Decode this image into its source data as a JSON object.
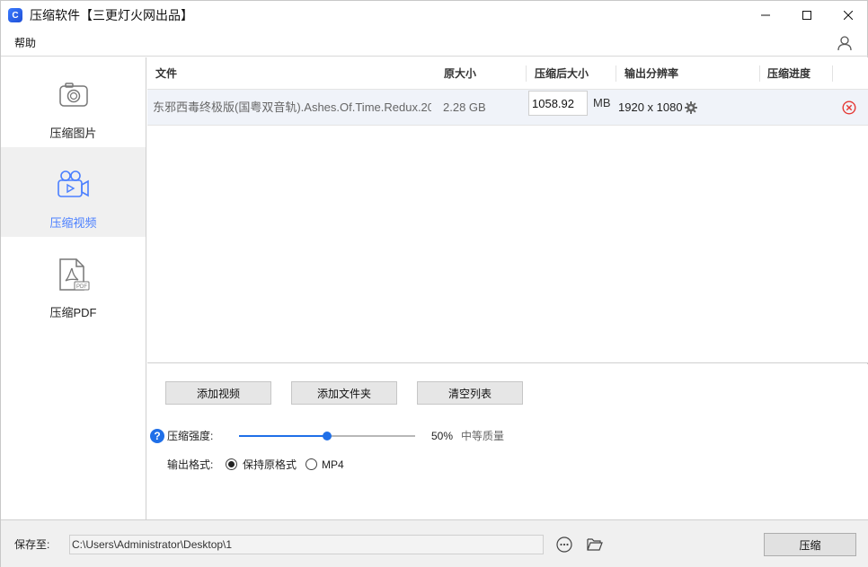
{
  "window": {
    "title": "压缩软件【三更灯火网出品】",
    "app_icon_letter": "C",
    "accent": "#4a7fff"
  },
  "menu": {
    "help_label": "帮助"
  },
  "sidebar": {
    "items": [
      {
        "label": "压缩图片",
        "icon": "camera-icon",
        "active": false
      },
      {
        "label": "压缩视频",
        "icon": "video-camera-icon",
        "active": true
      },
      {
        "label": "压缩PDF",
        "icon": "pdf-file-icon",
        "active": false
      }
    ]
  },
  "table": {
    "columns": [
      "文件",
      "原大小",
      "压缩后大小",
      "输出分辨率",
      "压缩进度"
    ],
    "rows": [
      {
        "file": "东邪西毒终极版(国粤双音轨).Ashes.Of.Time.Redux.20...",
        "original_size": "2.28 GB",
        "target_size": "1058.92",
        "target_unit": "MB",
        "resolution": "1920 x 1080",
        "progress": ""
      }
    ]
  },
  "controls": {
    "add_video_label": "添加视频",
    "add_folder_label": "添加文件夹",
    "clear_list_label": "清空列表",
    "strength_label": "压缩强度:",
    "strength_value": 50,
    "strength_percent": "50%",
    "quality_label": "中等质量",
    "format_label": "输出格式:",
    "format_options": [
      "保持原格式",
      "MP4"
    ],
    "format_selected": "保持原格式"
  },
  "bottom": {
    "save_label": "保存至:",
    "save_path": "C:\\Users\\Administrator\\Desktop\\1",
    "compress_label": "压缩"
  }
}
